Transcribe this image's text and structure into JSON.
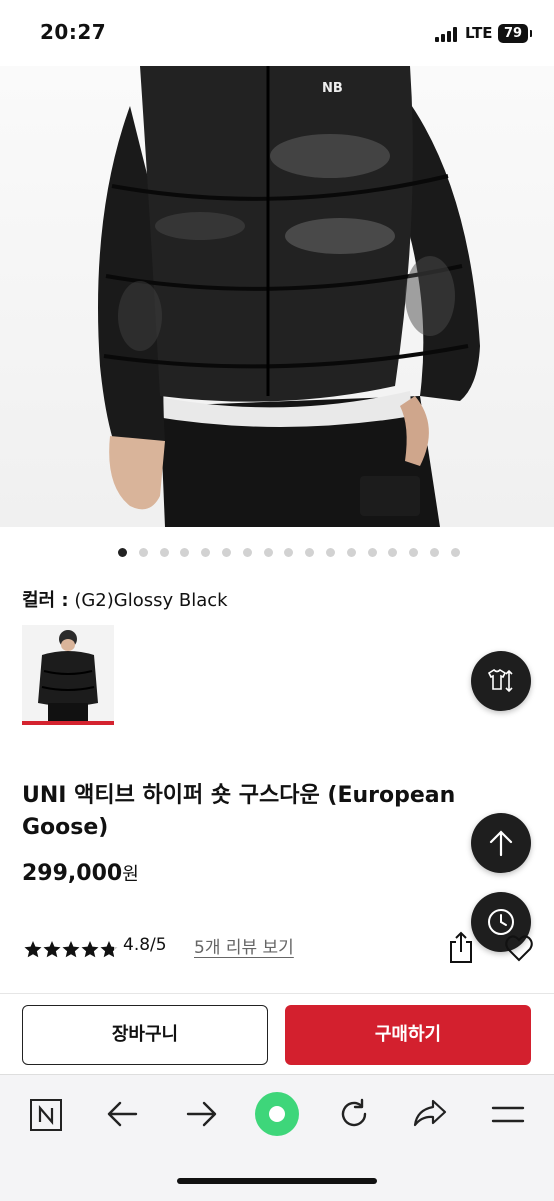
{
  "status_bar": {
    "time": "20:27",
    "network": "LTE",
    "battery": "79"
  },
  "gallery": {
    "total_images": 17,
    "active_index": 0
  },
  "color_option": {
    "label": "컬러 :",
    "value": "(G2)Glossy Black"
  },
  "product": {
    "title": "UNI 액티브 하이퍼 숏 구스다운 (European Goose)",
    "price": "299,000",
    "currency": "원",
    "rating_stars": 4.8,
    "rating_text": "4.8/5",
    "reviews_link": "5개 리뷰 보기"
  },
  "actions": {
    "cart_label": "장바구니",
    "buy_label": "구매하기"
  },
  "colors": {
    "accent": "#d3202e",
    "fab": "#1e1e1e"
  },
  "icons": {
    "size_guide": "shirt-swap-icon",
    "scroll_top": "arrow-up-icon",
    "recent": "clock-icon",
    "share": "share-icon",
    "wishlist": "heart-icon"
  },
  "browser_toolbar": [
    "naver-n-icon",
    "back-arrow-icon",
    "forward-arrow-icon",
    "green-dot-icon",
    "refresh-icon",
    "share-arrow-icon",
    "menu-icon"
  ]
}
